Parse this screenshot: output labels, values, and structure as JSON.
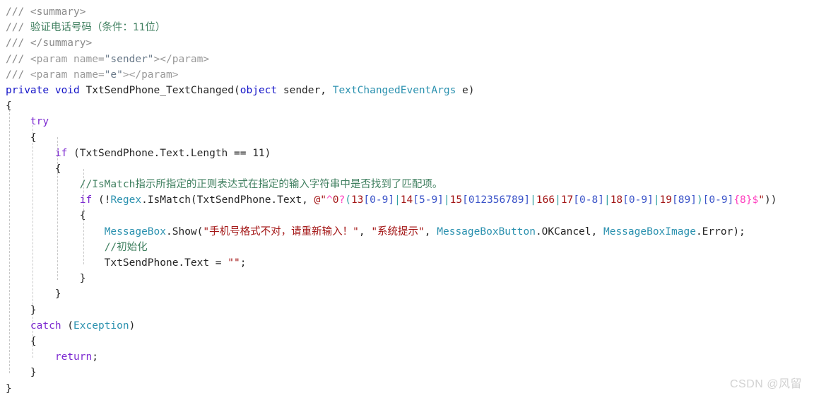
{
  "editor": {
    "language": "csharp",
    "background_color": "#ffffff",
    "indent_guide_color": "#c8c8c8",
    "watermark": "CSDN @风留",
    "colors": {
      "keyword_purple": "#7d2ad1",
      "keyword_blue": "#1414c8",
      "type_teal": "#2b91af",
      "comment_gray": "#8a8a8a",
      "comment_green": "#3f7f5f",
      "string_red": "#a31515",
      "regex_magenta": "#ff3fbf",
      "regex_group_teal": "#30a0a0",
      "regex_class_blue": "#3a53c8",
      "plain_text": "#262626"
    },
    "indent_guides_x": [
      13,
      46,
      81,
      118
    ],
    "lines": [
      {
        "n": 1,
        "text": "/// <summary>",
        "tokens": [
          {
            "t": "/// ",
            "c": "cmt"
          },
          {
            "t": "<summary>",
            "c": "cmt"
          }
        ]
      },
      {
        "n": 2,
        "text": "/// 验证电话号码（条件：11位）",
        "tokens": [
          {
            "t": "/// ",
            "c": "cmt"
          },
          {
            "t": "验证电话号码（条件：11位）",
            "c": "cmtg"
          }
        ]
      },
      {
        "n": 3,
        "text": "/// </summary>",
        "tokens": [
          {
            "t": "/// ",
            "c": "cmt"
          },
          {
            "t": "</summary>",
            "c": "cmt"
          }
        ]
      },
      {
        "n": 4,
        "text": "/// <param name=\"sender\"></param>",
        "tokens": [
          {
            "t": "/// ",
            "c": "cmt"
          },
          {
            "t": "<param name=",
            "c": "xmlname"
          },
          {
            "t": "\"sender\"",
            "c": "xmlval"
          },
          {
            "t": "></param>",
            "c": "xmlname"
          }
        ]
      },
      {
        "n": 5,
        "text": "/// <param name=\"e\"></param>",
        "tokens": [
          {
            "t": "/// ",
            "c": "cmt"
          },
          {
            "t": "<param name=",
            "c": "xmlname"
          },
          {
            "t": "\"e\"",
            "c": "xmlval"
          },
          {
            "t": "></param>",
            "c": "xmlname"
          }
        ]
      },
      {
        "n": 6,
        "text": "private void TxtSendPhone_TextChanged(object sender, TextChangedEventArgs e)",
        "tokens": [
          {
            "t": "private",
            "c": "kwb"
          },
          {
            "t": " ",
            "c": "id"
          },
          {
            "t": "void",
            "c": "kwb"
          },
          {
            "t": " TxtSendPhone_TextChanged(",
            "c": "id"
          },
          {
            "t": "object",
            "c": "kwb"
          },
          {
            "t": " sender, ",
            "c": "id"
          },
          {
            "t": "TextChangedEventArgs",
            "c": "type"
          },
          {
            "t": " e)",
            "c": "id"
          }
        ]
      },
      {
        "n": 7,
        "text": "{",
        "tokens": [
          {
            "t": "{",
            "c": "id"
          }
        ]
      },
      {
        "n": 8,
        "text": "    try",
        "tokens": [
          {
            "t": "    ",
            "c": "id"
          },
          {
            "t": "try",
            "c": "kw"
          }
        ]
      },
      {
        "n": 9,
        "text": "    {",
        "tokens": [
          {
            "t": "    {",
            "c": "id"
          }
        ]
      },
      {
        "n": 10,
        "text": "        if (TxtSendPhone.Text.Length == 11)",
        "tokens": [
          {
            "t": "        ",
            "c": "id"
          },
          {
            "t": "if",
            "c": "kw"
          },
          {
            "t": " (TxtSendPhone.Text.Length == 11)",
            "c": "id"
          }
        ]
      },
      {
        "n": 11,
        "text": "        {",
        "tokens": [
          {
            "t": "        {",
            "c": "id"
          }
        ]
      },
      {
        "n": 12,
        "text": "            //IsMatch指示所指定的正则表达式在指定的输入字符串中是否找到了匹配项。",
        "tokens": [
          {
            "t": "            ",
            "c": "id"
          },
          {
            "t": "//IsMatch指示所指定的正则表达式在指定的输入字符串中是否找到了匹配项。",
            "c": "cmtg"
          }
        ]
      },
      {
        "n": 13,
        "text": "            if (!Regex.IsMatch(TxtSendPhone.Text, @\"^0?(13[0-9]|14[5-9]|15[012356789]|166|17[0-8]|18[0-9]|19[89])[0-9]{8}$\"))",
        "tokens": [
          {
            "t": "            ",
            "c": "id"
          },
          {
            "t": "if",
            "c": "kw"
          },
          {
            "t": " (!",
            "c": "id"
          },
          {
            "t": "Regex",
            "c": "type"
          },
          {
            "t": ".IsMatch(TxtSendPhone.Text, ",
            "c": "id"
          },
          {
            "t": "@\"",
            "c": "rxlit"
          },
          {
            "t": "^",
            "c": "rxmeta"
          },
          {
            "t": "0",
            "c": "rxlit"
          },
          {
            "t": "?",
            "c": "rxmeta"
          },
          {
            "t": "(",
            "c": "rxgrp"
          },
          {
            "t": "13",
            "c": "rxlit"
          },
          {
            "t": "[0-9]",
            "c": "rxset"
          },
          {
            "t": "|",
            "c": "rxgrp"
          },
          {
            "t": "14",
            "c": "rxlit"
          },
          {
            "t": "[5-9]",
            "c": "rxset"
          },
          {
            "t": "|",
            "c": "rxgrp"
          },
          {
            "t": "15",
            "c": "rxlit"
          },
          {
            "t": "[012356789]",
            "c": "rxset"
          },
          {
            "t": "|",
            "c": "rxgrp"
          },
          {
            "t": "166",
            "c": "rxlit"
          },
          {
            "t": "|",
            "c": "rxgrp"
          },
          {
            "t": "17",
            "c": "rxlit"
          },
          {
            "t": "[0-8]",
            "c": "rxset"
          },
          {
            "t": "|",
            "c": "rxgrp"
          },
          {
            "t": "18",
            "c": "rxlit"
          },
          {
            "t": "[0-9]",
            "c": "rxset"
          },
          {
            "t": "|",
            "c": "rxgrp"
          },
          {
            "t": "19",
            "c": "rxlit"
          },
          {
            "t": "[89]",
            "c": "rxset"
          },
          {
            "t": ")",
            "c": "rxgrp"
          },
          {
            "t": "[0-9]",
            "c": "rxset"
          },
          {
            "t": "{8}",
            "c": "rxmeta"
          },
          {
            "t": "$",
            "c": "rxmeta"
          },
          {
            "t": "\"",
            "c": "rxlit"
          },
          {
            "t": "))",
            "c": "id"
          }
        ]
      },
      {
        "n": 14,
        "text": "            {",
        "tokens": [
          {
            "t": "            {",
            "c": "id"
          }
        ]
      },
      {
        "n": 15,
        "text": "                MessageBox.Show(\"手机号格式不对，请重新输入！\", \"系统提示\", MessageBoxButton.OKCancel, MessageBoxImage.Error);",
        "tokens": [
          {
            "t": "                ",
            "c": "id"
          },
          {
            "t": "MessageBox",
            "c": "type"
          },
          {
            "t": ".Show(",
            "c": "id"
          },
          {
            "t": "\"手机号格式不对，请重新输入！\"",
            "c": "str"
          },
          {
            "t": ", ",
            "c": "id"
          },
          {
            "t": "\"系统提示\"",
            "c": "str"
          },
          {
            "t": ", ",
            "c": "id"
          },
          {
            "t": "MessageBoxButton",
            "c": "type"
          },
          {
            "t": ".OKCancel, ",
            "c": "id"
          },
          {
            "t": "MessageBoxImage",
            "c": "type"
          },
          {
            "t": ".Error);",
            "c": "id"
          }
        ]
      },
      {
        "n": 16,
        "text": "                //初始化",
        "tokens": [
          {
            "t": "                ",
            "c": "id"
          },
          {
            "t": "//初始化",
            "c": "cmtg"
          }
        ]
      },
      {
        "n": 17,
        "text": "                TxtSendPhone.Text = \"\";",
        "tokens": [
          {
            "t": "                TxtSendPhone.Text = ",
            "c": "id"
          },
          {
            "t": "\"\"",
            "c": "str"
          },
          {
            "t": ";",
            "c": "id"
          }
        ]
      },
      {
        "n": 18,
        "text": "            }",
        "tokens": [
          {
            "t": "            }",
            "c": "id"
          }
        ]
      },
      {
        "n": 19,
        "text": "        }",
        "tokens": [
          {
            "t": "        }",
            "c": "id"
          }
        ]
      },
      {
        "n": 20,
        "text": "    }",
        "tokens": [
          {
            "t": "    }",
            "c": "id"
          }
        ]
      },
      {
        "n": 21,
        "text": "    catch (Exception)",
        "tokens": [
          {
            "t": "    ",
            "c": "id"
          },
          {
            "t": "catch",
            "c": "kw"
          },
          {
            "t": " (",
            "c": "id"
          },
          {
            "t": "Exception",
            "c": "type"
          },
          {
            "t": ")",
            "c": "id"
          }
        ]
      },
      {
        "n": 22,
        "text": "    {",
        "tokens": [
          {
            "t": "    {",
            "c": "id"
          }
        ]
      },
      {
        "n": 23,
        "text": "        return;",
        "tokens": [
          {
            "t": "        ",
            "c": "id"
          },
          {
            "t": "return",
            "c": "kw"
          },
          {
            "t": ";",
            "c": "id"
          }
        ]
      },
      {
        "n": 24,
        "text": "    }",
        "tokens": [
          {
            "t": "    }",
            "c": "id"
          }
        ]
      },
      {
        "n": 25,
        "text": "}",
        "tokens": [
          {
            "t": "}",
            "c": "id"
          }
        ]
      }
    ]
  }
}
